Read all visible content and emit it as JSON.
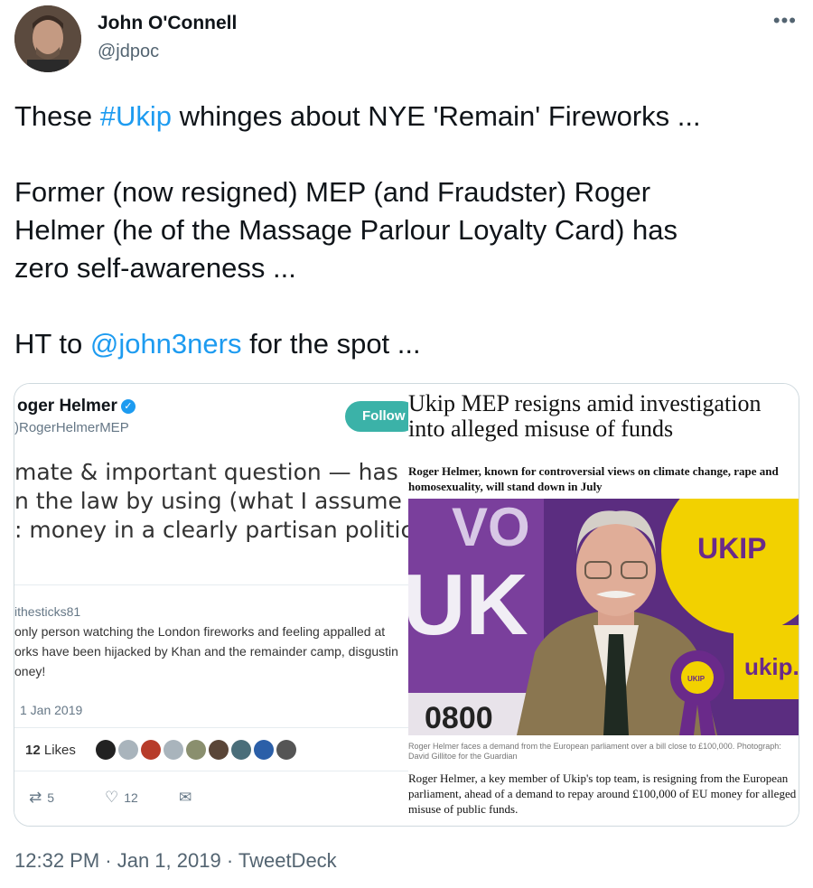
{
  "author": {
    "name": "John O'Connell",
    "handle": "@jdpoc"
  },
  "more_icon": "more-horizontal-icon",
  "tweet": {
    "line1_pre": "These ",
    "line1_hashtag": "#Ukip",
    "line1_post": " whinges about NYE 'Remain' Fireworks ...",
    "para2": "Former (now resigned) MEP (and Fraudster) Roger\nHelmer (he of the Massage Parlour Loyalty Card) has\nzero self-awareness ...",
    "line3_pre": "HT to ",
    "line3_mention": "@john3ners",
    "line3_post": " for the spot ..."
  },
  "embedded_tweet": {
    "name": "oger Helmer",
    "verified_icon": "verified-check-icon",
    "handle": ")RogerHelmerMEP",
    "follow_label": "Follow",
    "big_text": "mate & important question — has\nn the law by using (what I assume\n: money in a clearly partisan politic",
    "quoted_handle": "ithesticks81",
    "quoted_line1": "only person watching the London fireworks and feeling appalled at",
    "quoted_line2": "orks have been hijacked by Khan and the remainder camp, disgustin",
    "quoted_line3": "oney!",
    "date": "1 Jan 2019",
    "likes_count": "12",
    "likes_label": "Likes",
    "retweet_icon": "retweet-icon",
    "retweets": "5",
    "like_icon": "heart-icon",
    "likes_action": "12",
    "message_icon": "envelope-icon"
  },
  "article": {
    "headline": "Ukip MEP resigns amid investigation into alleged misuse of funds",
    "standfirst": "Roger Helmer, known for controversial views on climate change, rape and homosexuality, will stand down in July",
    "sign_text_vo": "VO",
    "sign_text_uk": "UK",
    "sign_text_phone": "0800",
    "banner_text_ukip": "UKIP",
    "banner_text_ukip_url": "ukip.",
    "rosette_text": "UKIP",
    "caption": "Roger Helmer faces a demand from the European parliament over a bill close to £100,000. Photograph: David Gillitoe for the Guardian",
    "body": "Roger Helmer, a key member of Ukip's top team, is resigning from the European parliament, ahead of a demand to repay around £100,000 of EU money for alleged misuse of public funds."
  },
  "footer": {
    "timestamp": "12:32 PM · Jan 1, 2019 · TweetDeck"
  },
  "colors": {
    "link": "#1d9bf0",
    "ukip_purple": "#6a2a8a",
    "ukip_yellow": "#f2d100"
  }
}
